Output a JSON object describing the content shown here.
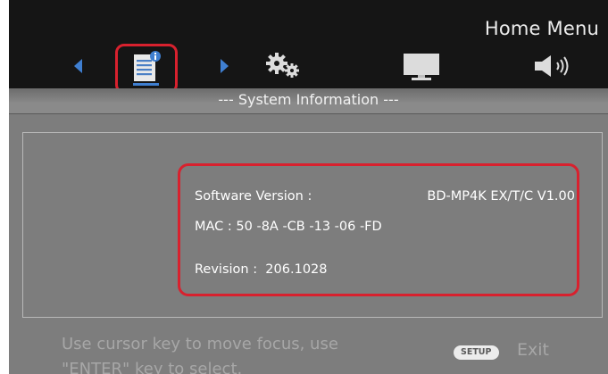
{
  "header": {
    "title": "Home Menu",
    "tabs": [
      {
        "name": "system-information",
        "icon": "document-info-icon",
        "selected": true
      },
      {
        "name": "setup",
        "icon": "gears-icon",
        "selected": false
      },
      {
        "name": "display",
        "icon": "monitor-icon",
        "selected": false
      },
      {
        "name": "audio",
        "icon": "speaker-icon",
        "selected": false
      }
    ]
  },
  "section": {
    "title": "--- System Information ---"
  },
  "info": {
    "software_label": "Software Version :",
    "software_value": "BD-MP4K EX/T/C V1.00",
    "mac_line": "MAC : 50 -8A -CB -13 -06 -FD",
    "revision_line": "Revision :  206.1028"
  },
  "footer": {
    "help_text": "Use cursor key to move focus, use \"ENTER\" key to select.",
    "setup_badge": "SETUP",
    "exit_label": "Exit"
  },
  "colors": {
    "header_bg": "#151515",
    "body_bg": "#7d7d7d",
    "highlight": "#d8212e",
    "arrow": "#3f7fd1"
  }
}
